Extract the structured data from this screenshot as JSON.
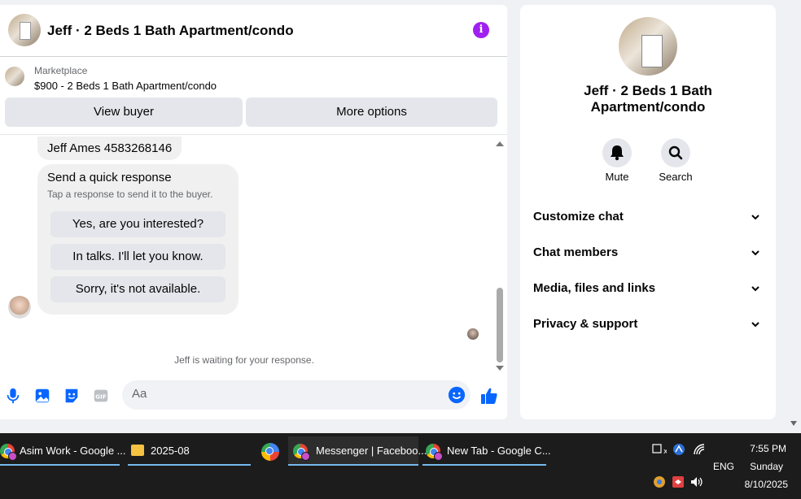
{
  "chat": {
    "title": "Jeff · 2 Beds 1 Bath Apartment/condo",
    "marketplace_label": "Marketplace",
    "listing": "$900 - 2 Beds 1 Bath Apartment/condo",
    "view_buyer": "View buyer",
    "more_options": "More options"
  },
  "messages": {
    "contact_bubble": "Jeff Ames 4583268146",
    "quick_title": "Send a quick response",
    "quick_subtitle": "Tap a response to send it to the buyer.",
    "quick_responses": [
      "Yes, are you interested?",
      "In talks. I'll let you know.",
      "Sorry, it's not available."
    ],
    "waiting": "Jeff is waiting for your response."
  },
  "composer": {
    "placeholder": "Aa"
  },
  "info": {
    "title": "Jeff · 2 Beds 1 Bath Apartment/condo",
    "mute": "Mute",
    "search": "Search",
    "sections": [
      "Customize chat",
      "Chat members",
      "Media, files and links",
      "Privacy & support"
    ]
  },
  "taskbar": {
    "items": [
      "Asim Work - Google ...",
      "2025-08",
      "Messenger | Faceboo...",
      "New Tab - Google C..."
    ],
    "lang": "ENG",
    "time": "7:55 PM",
    "day": "Sunday",
    "date": "8/10/2025"
  },
  "colors": {
    "accent": "#0866ff",
    "info_icon": "#a020f0",
    "taskbar": "#1c1c1c"
  }
}
